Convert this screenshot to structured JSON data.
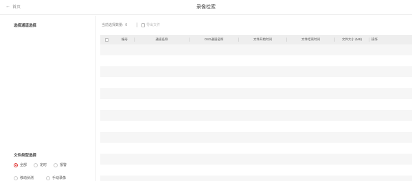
{
  "header": {
    "back_label": "首页",
    "back_icon": "arrow-left-icon",
    "title": "录像检索"
  },
  "sidebar": {
    "channel_section_title": "选择通道选择",
    "file_type_section_title": "文件类型选择",
    "file_types_row1": [
      {
        "label": "全部",
        "selected": true
      },
      {
        "label": "定时",
        "selected": false
      },
      {
        "label": "报警",
        "selected": false
      }
    ],
    "file_types_row2": [
      {
        "label": "移动侦测",
        "selected": false
      },
      {
        "label": "手动录像",
        "selected": false
      }
    ]
  },
  "toolbar": {
    "selected_label": "当前选择数量:",
    "selected_count": "0",
    "export_label": "导出文件",
    "export_icon": "file-icon"
  },
  "table": {
    "columns": [
      "编号",
      "通道名称",
      "OSD通道名称",
      "文件开始时间",
      "文件结束时间",
      "文件大小 (MB)",
      "操作"
    ],
    "rows": []
  },
  "colors": {
    "accent": "#e0312f",
    "header_bg": "#eeeeee",
    "stripe": "#f6f6f6"
  }
}
